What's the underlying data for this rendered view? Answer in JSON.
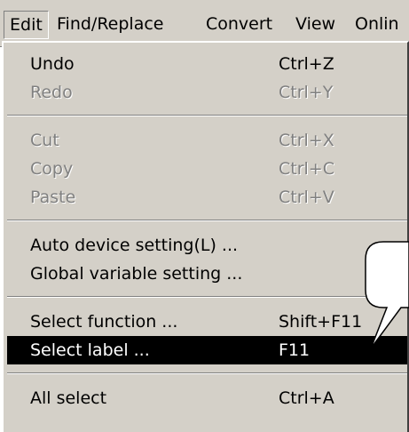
{
  "menubar": {
    "items": [
      "Edit",
      "Find/Replace",
      "Convert",
      "View",
      "Onlin"
    ]
  },
  "menu": {
    "undo": {
      "label": "Undo",
      "shortcut": "Ctrl+Z"
    },
    "redo": {
      "label": "Redo",
      "shortcut": "Ctrl+Y"
    },
    "cut": {
      "label": "Cut",
      "shortcut": "Ctrl+X"
    },
    "copy": {
      "label": "Copy",
      "shortcut": "Ctrl+C"
    },
    "paste": {
      "label": "Paste",
      "shortcut": "Ctrl+V"
    },
    "auto_device": {
      "label": "Auto device setting(L) ..."
    },
    "global_var": {
      "label": "Global variable setting ..."
    },
    "select_function": {
      "label": "Select function ...",
      "shortcut": "Shift+F11"
    },
    "select_label": {
      "label": "Select label ...",
      "shortcut": "F11"
    },
    "all_select": {
      "label": "All select",
      "shortcut": "Ctrl+A"
    }
  },
  "colors": {
    "menu_bg": "#d4d0c8",
    "highlight_bg": "#000000",
    "highlight_text": "#ffffff",
    "disabled_text": "#808080"
  }
}
